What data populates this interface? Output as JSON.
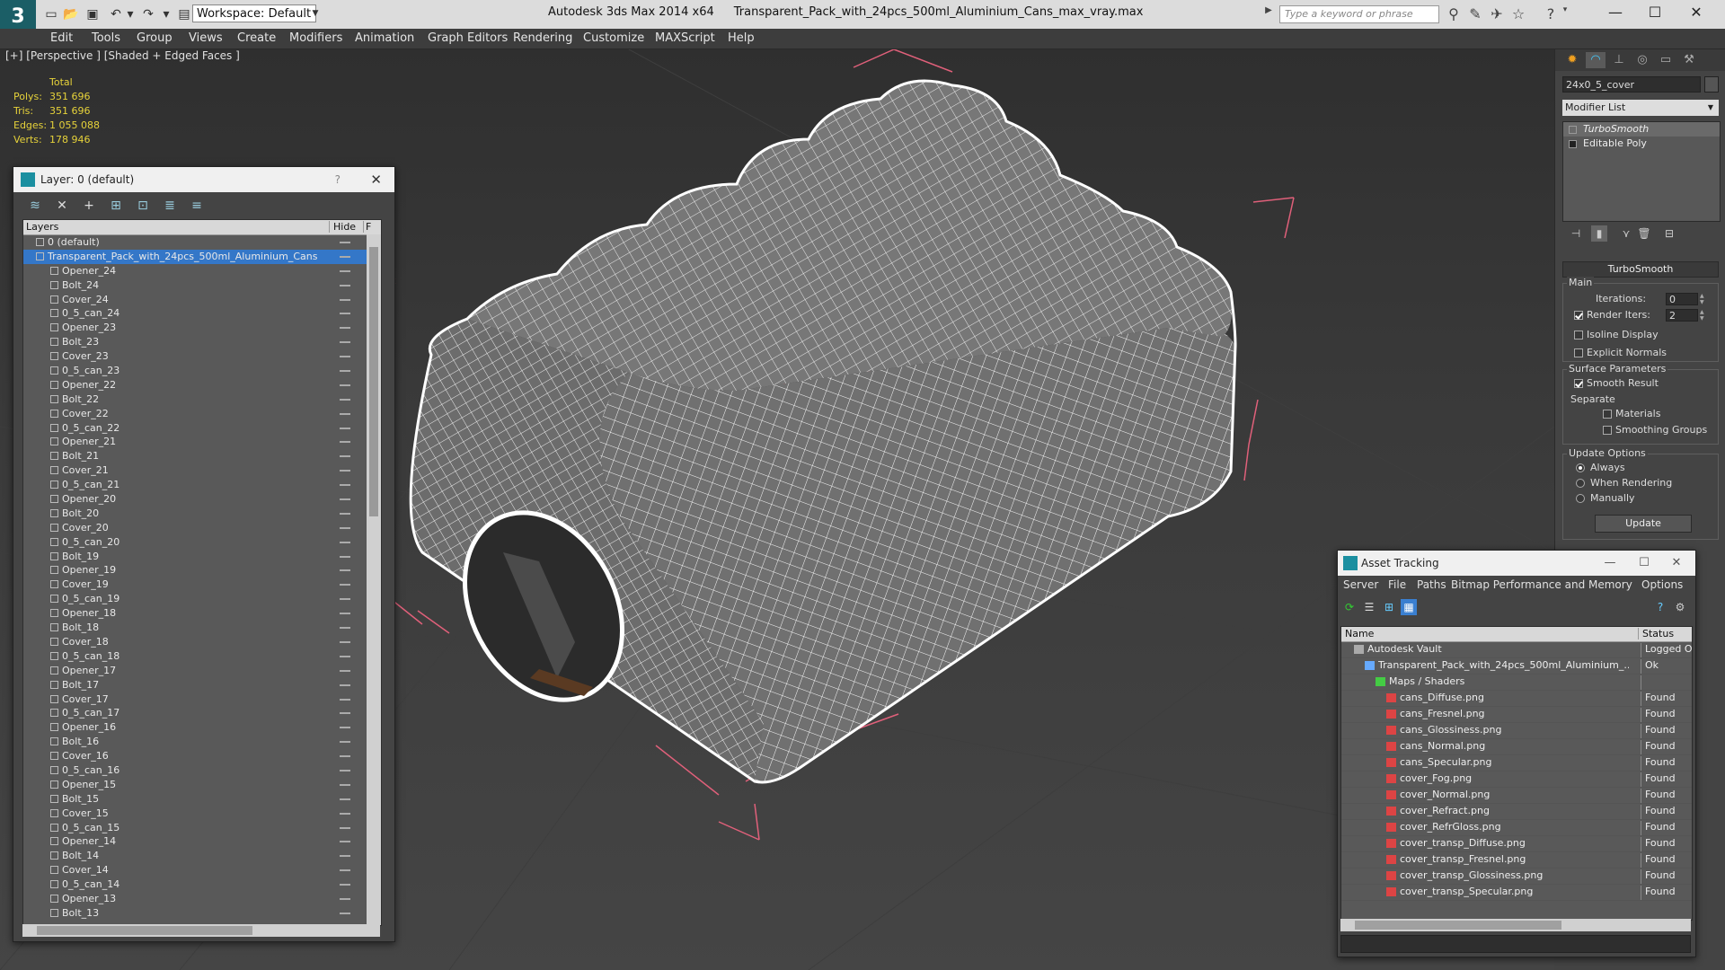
{
  "titlebar": {
    "workspace_label": "Workspace: Default",
    "app_title": "Autodesk 3ds Max  2014 x64",
    "document_title": "Transparent_Pack_with_24pcs_500ml_Aluminium_Cans_max_vray.max",
    "search_placeholder": "Type a keyword or phrase"
  },
  "menu": [
    "Edit",
    "Tools",
    "Group",
    "Views",
    "Create",
    "Modifiers",
    "Animation",
    "Graph Editors",
    "Rendering",
    "Customize",
    "MAXScript",
    "Help"
  ],
  "viewport": {
    "label": "[+] [Perspective ] [Shaded + Edged Faces ]",
    "stats": {
      "header": "Total",
      "rows": [
        {
          "label": "Polys:",
          "value": "351 696"
        },
        {
          "label": "Tris:",
          "value": "351 696"
        },
        {
          "label": "Edges:",
          "value": "1 055 088"
        },
        {
          "label": "Verts:",
          "value": "178 946"
        }
      ]
    }
  },
  "layer_dialog": {
    "title": "Layer: 0 (default)",
    "help": "?",
    "col_layers": "Layers",
    "col_hide": "Hide",
    "col_f": "F",
    "rows": [
      {
        "name": "0 (default)",
        "level": 0,
        "selected": false
      },
      {
        "name": "Transparent_Pack_with_24pcs_500ml_Aluminium_Cans",
        "level": 0,
        "selected": true
      },
      {
        "name": "Opener_24",
        "level": 1
      },
      {
        "name": "Bolt_24",
        "level": 1
      },
      {
        "name": "Cover_24",
        "level": 1
      },
      {
        "name": "0_5_can_24",
        "level": 1
      },
      {
        "name": "Opener_23",
        "level": 1
      },
      {
        "name": "Bolt_23",
        "level": 1
      },
      {
        "name": "Cover_23",
        "level": 1
      },
      {
        "name": "0_5_can_23",
        "level": 1
      },
      {
        "name": "Opener_22",
        "level": 1
      },
      {
        "name": "Bolt_22",
        "level": 1
      },
      {
        "name": "Cover_22",
        "level": 1
      },
      {
        "name": "0_5_can_22",
        "level": 1
      },
      {
        "name": "Opener_21",
        "level": 1
      },
      {
        "name": "Bolt_21",
        "level": 1
      },
      {
        "name": "Cover_21",
        "level": 1
      },
      {
        "name": "0_5_can_21",
        "level": 1
      },
      {
        "name": "Opener_20",
        "level": 1
      },
      {
        "name": "Bolt_20",
        "level": 1
      },
      {
        "name": "Cover_20",
        "level": 1
      },
      {
        "name": "0_5_can_20",
        "level": 1
      },
      {
        "name": "Bolt_19",
        "level": 1
      },
      {
        "name": "Opener_19",
        "level": 1
      },
      {
        "name": "Cover_19",
        "level": 1
      },
      {
        "name": "0_5_can_19",
        "level": 1
      },
      {
        "name": "Opener_18",
        "level": 1
      },
      {
        "name": "Bolt_18",
        "level": 1
      },
      {
        "name": "Cover_18",
        "level": 1
      },
      {
        "name": "0_5_can_18",
        "level": 1
      },
      {
        "name": "Opener_17",
        "level": 1
      },
      {
        "name": "Bolt_17",
        "level": 1
      },
      {
        "name": "Cover_17",
        "level": 1
      },
      {
        "name": "0_5_can_17",
        "level": 1
      },
      {
        "name": "Opener_16",
        "level": 1
      },
      {
        "name": "Bolt_16",
        "level": 1
      },
      {
        "name": "Cover_16",
        "level": 1
      },
      {
        "name": "0_5_can_16",
        "level": 1
      },
      {
        "name": "Opener_15",
        "level": 1
      },
      {
        "name": "Bolt_15",
        "level": 1
      },
      {
        "name": "Cover_15",
        "level": 1
      },
      {
        "name": "0_5_can_15",
        "level": 1
      },
      {
        "name": "Opener_14",
        "level": 1
      },
      {
        "name": "Bolt_14",
        "level": 1
      },
      {
        "name": "Cover_14",
        "level": 1
      },
      {
        "name": "0_5_can_14",
        "level": 1
      },
      {
        "name": "Opener_13",
        "level": 1
      },
      {
        "name": "Bolt_13",
        "level": 1
      }
    ]
  },
  "command_panel": {
    "object_name": "24x0_5_cover",
    "modifier_list": "Modifier List",
    "stack": [
      {
        "name": "TurboSmooth",
        "selected": true
      },
      {
        "name": "Editable Poly",
        "selected": false
      }
    ],
    "rollout": {
      "title": "TurboSmooth",
      "main_label": "Main",
      "iterations_label": "Iterations:",
      "iterations_value": "0",
      "render_iters_label": "Render Iters:",
      "render_iters_value": "2",
      "render_iters_checked": true,
      "isoline_label": "Isoline Display",
      "explicit_label": "Explicit Normals",
      "surface_label": "Surface Parameters",
      "smooth_label": "Smooth Result",
      "smooth_checked": true,
      "separate_label": "Separate",
      "materials_label": "Materials",
      "smoothing_groups_label": "Smoothing Groups",
      "update_options_label": "Update Options",
      "always_label": "Always",
      "when_rendering_label": "When Rendering",
      "manually_label": "Manually",
      "update_button": "Update"
    }
  },
  "asset_tracking": {
    "title": "Asset Tracking",
    "menu": [
      "Server",
      "File",
      "Paths",
      "Bitmap Performance and Memory",
      "Options"
    ],
    "col_name": "Name",
    "col_status": "Status",
    "rows": [
      {
        "name": "Autodesk Vault",
        "status": "Logged O",
        "level": 0,
        "icon": "vault"
      },
      {
        "name": "Transparent_Pack_with_24pcs_500ml_Aluminium_...",
        "status": "Ok",
        "level": 1,
        "icon": "max"
      },
      {
        "name": "Maps / Shaders",
        "status": "",
        "level": 2,
        "icon": "maps"
      },
      {
        "name": "cans_Diffuse.png",
        "status": "Found",
        "level": 3,
        "icon": "png"
      },
      {
        "name": "cans_Fresnel.png",
        "status": "Found",
        "level": 3,
        "icon": "png"
      },
      {
        "name": "cans_Glossiness.png",
        "status": "Found",
        "level": 3,
        "icon": "png"
      },
      {
        "name": "cans_Normal.png",
        "status": "Found",
        "level": 3,
        "icon": "png"
      },
      {
        "name": "cans_Specular.png",
        "status": "Found",
        "level": 3,
        "icon": "png"
      },
      {
        "name": "cover_Fog.png",
        "status": "Found",
        "level": 3,
        "icon": "png"
      },
      {
        "name": "cover_Normal.png",
        "status": "Found",
        "level": 3,
        "icon": "png"
      },
      {
        "name": "cover_Refract.png",
        "status": "Found",
        "level": 3,
        "icon": "png"
      },
      {
        "name": "cover_RefrGloss.png",
        "status": "Found",
        "level": 3,
        "icon": "png"
      },
      {
        "name": "cover_transp_Diffuse.png",
        "status": "Found",
        "level": 3,
        "icon": "png"
      },
      {
        "name": "cover_transp_Fresnel.png",
        "status": "Found",
        "level": 3,
        "icon": "png"
      },
      {
        "name": "cover_transp_Glossiness.png",
        "status": "Found",
        "level": 3,
        "icon": "png"
      },
      {
        "name": "cover_transp_Specular.png",
        "status": "Found",
        "level": 3,
        "icon": "png"
      }
    ]
  },
  "colors": {
    "selection": "#3477c8",
    "stats_text": "#e6d23a",
    "bounding_box": "#e0607a"
  }
}
